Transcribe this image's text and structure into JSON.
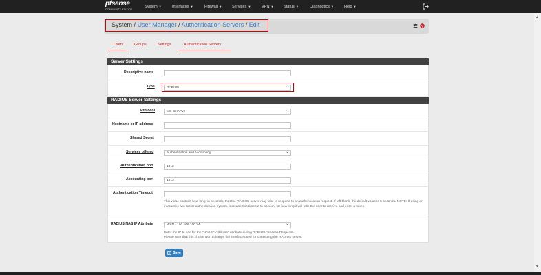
{
  "nav": {
    "logo_text": "pfsense",
    "logo_sub": "COMMUNITY EDITION",
    "menus": [
      "System",
      "Interfaces",
      "Firewall",
      "Services",
      "VPN",
      "Status",
      "Diagnostics",
      "Help"
    ]
  },
  "breadcrumb": {
    "root": "System",
    "sep": "/",
    "items": [
      "User Manager",
      "Authentication Servers",
      "Edit"
    ]
  },
  "tabs": [
    "Users",
    "Groups",
    "Settings",
    "Authentication Servers"
  ],
  "server_settings": {
    "heading": "Server Settings",
    "descriptive_name_label": "Descriptive name",
    "descriptive_name_value": "",
    "type_label": "Type",
    "type_value": "RADIUS"
  },
  "radius_settings": {
    "heading": "RADIUS Server Settings",
    "protocol_label": "Protocol",
    "protocol_value": "MS-CHAPv2",
    "hostname_label": "Hostname or IP address",
    "hostname_value": "",
    "secret_label": "Shared Secret",
    "secret_value": "",
    "services_label": "Services offered",
    "services_value": "Authentication and Accounting",
    "auth_port_label": "Authentication port",
    "auth_port_value": "1812",
    "acct_port_label": "Accounting port",
    "acct_port_value": "1813",
    "timeout_label": "Authentication Timeout",
    "timeout_value": "",
    "timeout_help": "This value controls how long, in seconds, that the RADIUS server may take to respond to an authentication request. If left blank, the default value is 5 seconds. NOTE: If using an interactive two-factor authentication system, increase this timeout to account for how long it will take the user to receive and enter a token.",
    "nas_label": "RADIUS NAS IP Attribute",
    "nas_value": "WAN - 192.168.100.24",
    "nas_help_1": "Enter the IP to use for the \"NAS-IP-Address\" attribute during RADIUS Acccess-Requests.",
    "nas_help_2": "Please note that this choice won't change the interface used for contacting the RADIUS server."
  },
  "save_label": "Save",
  "colors": {
    "accent": "#d12b2b",
    "link": "#3b80c3",
    "nav_bg": "#212121",
    "button": "#2f7fc1"
  }
}
